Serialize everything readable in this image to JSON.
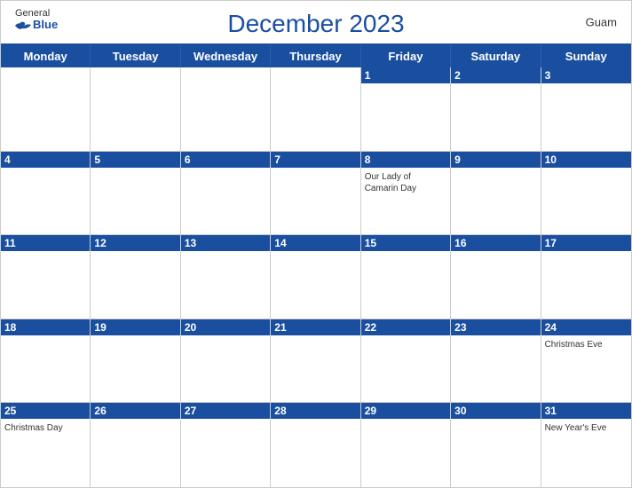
{
  "header": {
    "title": "December 2023",
    "region": "Guam",
    "logo_general": "General",
    "logo_blue": "Blue"
  },
  "dayHeaders": [
    "Monday",
    "Tuesday",
    "Wednesday",
    "Thursday",
    "Friday",
    "Saturday",
    "Sunday"
  ],
  "weeks": [
    [
      {
        "day": "",
        "event": ""
      },
      {
        "day": "",
        "event": ""
      },
      {
        "day": "",
        "event": ""
      },
      {
        "day": "",
        "event": ""
      },
      {
        "day": "1",
        "event": ""
      },
      {
        "day": "2",
        "event": ""
      },
      {
        "day": "3",
        "event": ""
      }
    ],
    [
      {
        "day": "4",
        "event": ""
      },
      {
        "day": "5",
        "event": ""
      },
      {
        "day": "6",
        "event": ""
      },
      {
        "day": "7",
        "event": ""
      },
      {
        "day": "8",
        "event": "Our Lady of Camarin Day"
      },
      {
        "day": "9",
        "event": ""
      },
      {
        "day": "10",
        "event": ""
      }
    ],
    [
      {
        "day": "11",
        "event": ""
      },
      {
        "day": "12",
        "event": ""
      },
      {
        "day": "13",
        "event": ""
      },
      {
        "day": "14",
        "event": ""
      },
      {
        "day": "15",
        "event": ""
      },
      {
        "day": "16",
        "event": ""
      },
      {
        "day": "17",
        "event": ""
      }
    ],
    [
      {
        "day": "18",
        "event": ""
      },
      {
        "day": "19",
        "event": ""
      },
      {
        "day": "20",
        "event": ""
      },
      {
        "day": "21",
        "event": ""
      },
      {
        "day": "22",
        "event": ""
      },
      {
        "day": "23",
        "event": ""
      },
      {
        "day": "24",
        "event": "Christmas Eve"
      }
    ],
    [
      {
        "day": "25",
        "event": "Christmas Day"
      },
      {
        "day": "26",
        "event": ""
      },
      {
        "day": "27",
        "event": ""
      },
      {
        "day": "28",
        "event": ""
      },
      {
        "day": "29",
        "event": ""
      },
      {
        "day": "30",
        "event": ""
      },
      {
        "day": "31",
        "event": "New Year's Eve"
      }
    ]
  ]
}
